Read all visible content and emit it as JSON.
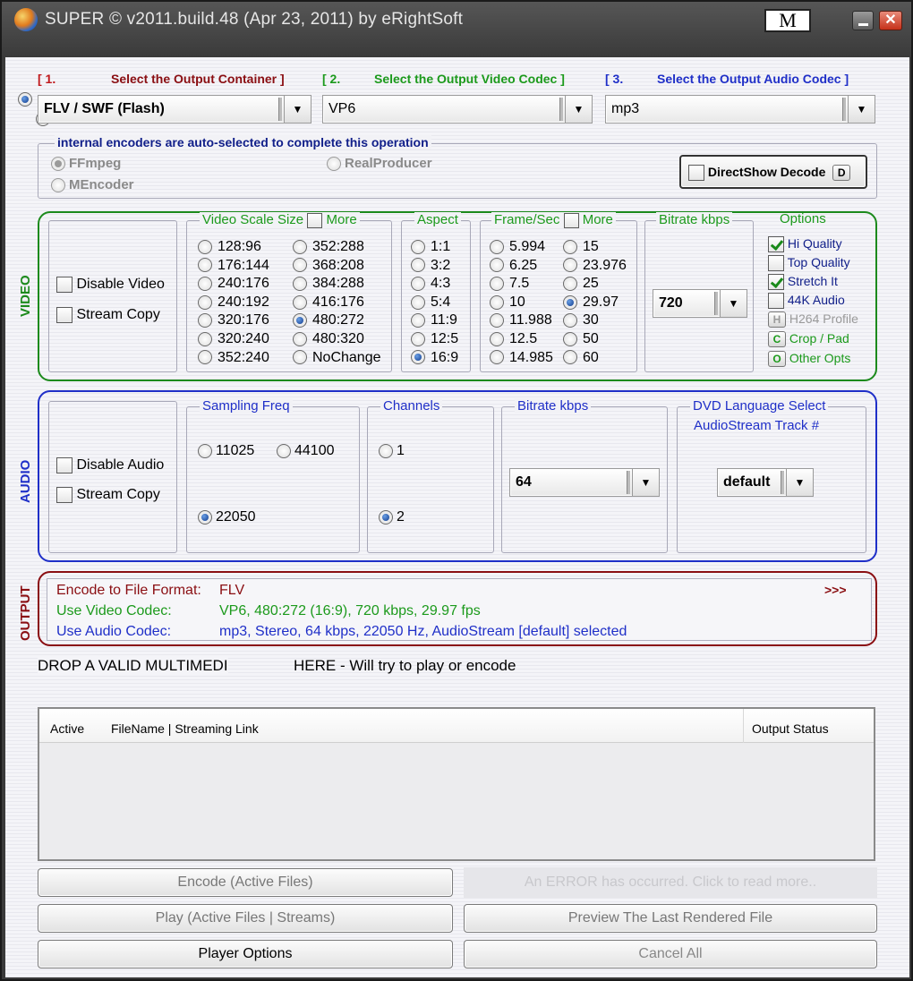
{
  "window": {
    "title": "SUPER © v2011.build.48 (Apr 23, 2011) by eRightSoft",
    "m_button": "M",
    "close_glyph": "✕"
  },
  "steps": {
    "step1_num": "[ 1.",
    "step1_label": "Select the Output Container ]",
    "step2_num": "[ 2.",
    "step2_label": "Select the Output Video Codec ]",
    "step3_num": "[ 3.",
    "step3_label": "Select the Output Audio Codec ]",
    "container": "FLV / SWF (Flash)",
    "video_codec": "VP6",
    "audio_codec": "mp3",
    "dropdown_glyph": "▼"
  },
  "encoders": {
    "label": "internal encoders are auto-selected to complete this operation",
    "ffmpeg": "FFmpeg",
    "mencoder": "MEncoder",
    "realproducer": "RealProducer",
    "directshow": "DirectShow Decode",
    "directshow_key": "D"
  },
  "video": {
    "side_label": "VIDEO",
    "disable": "Disable Video",
    "stream_copy": "Stream Copy",
    "scale_label": "Video Scale Size",
    "more": "More",
    "scale_col1": [
      "128:96",
      "176:144",
      "240:176",
      "240:192",
      "320:176",
      "320:240",
      "352:240"
    ],
    "scale_col2": [
      "352:288",
      "368:208",
      "384:288",
      "416:176",
      "480:272",
      "480:320",
      "NoChange"
    ],
    "aspect_label": "Aspect",
    "aspects": [
      "1:1",
      "3:2",
      "4:3",
      "5:4",
      "11:9",
      "12:5",
      "16:9"
    ],
    "fps_label": "Frame/Sec",
    "fps_col1": [
      "5.994",
      "6.25",
      "7.5",
      "10",
      "11.988",
      "12.5",
      "14.985"
    ],
    "fps_col2": [
      "15",
      "23.976",
      "25",
      "29.97",
      "30",
      "50",
      "60"
    ],
    "bitrate_label": "Bitrate  kbps",
    "bitrate": "720",
    "options_label": "Options",
    "opt_hq": "Hi Quality",
    "opt_tq": "Top Quality",
    "opt_stretch": "Stretch It",
    "opt_44k": "44K Audio",
    "opt_h264": "H264 Profile",
    "opt_h264_key": "H",
    "opt_crop": "Crop / Pad",
    "opt_crop_key": "C",
    "opt_other": "Other Opts",
    "opt_other_key": "O"
  },
  "audio": {
    "side_label": "AUDIO",
    "disable": "Disable Audio",
    "stream_copy": "Stream Copy",
    "sampling_label": "Sampling Freq",
    "f11025": "11025",
    "f44100": "44100",
    "f22050": "22050",
    "channels_label": "Channels",
    "ch1": "1",
    "ch2": "2",
    "bitrate_label": "Bitrate  kbps",
    "bitrate": "64",
    "dvd_label1": "DVD Language Select",
    "dvd_label2": "AudioStream  Track #",
    "dvd_value": "default"
  },
  "output": {
    "side_label": "OUTPUT",
    "format_key": "Encode to File Format:",
    "format_val": "FLV",
    "more": ">>>",
    "video_key": "Use Video Codec:",
    "video_val": "VP6,  480:272 (16:9),  720 kbps,  29.97 fps",
    "audio_key": "Use Audio Codec:",
    "audio_val": "mp3,  Stereo,  64 kbps,  22050 Hz,  AudioStream [default] selected"
  },
  "drop": {
    "left": "DROP A VALID MULTIMEDI",
    "right": "HERE - Will try to play or encode"
  },
  "filelist": {
    "col_active": "Active",
    "col_filename": "FileName  |  Streaming Link",
    "col_status": "Output Status"
  },
  "buttons": {
    "encode": "Encode (Active Files)",
    "error": "An ERROR has occurred. Click to read more..",
    "play": "Play (Active Files | Streams)",
    "preview": "Preview The Last Rendered File",
    "player_options": "Player Options",
    "cancel": "Cancel All"
  },
  "colors": {
    "video_frame": "#1c8a1c",
    "audio_frame": "#1f2fc8",
    "output_frame": "#8a0e12"
  }
}
